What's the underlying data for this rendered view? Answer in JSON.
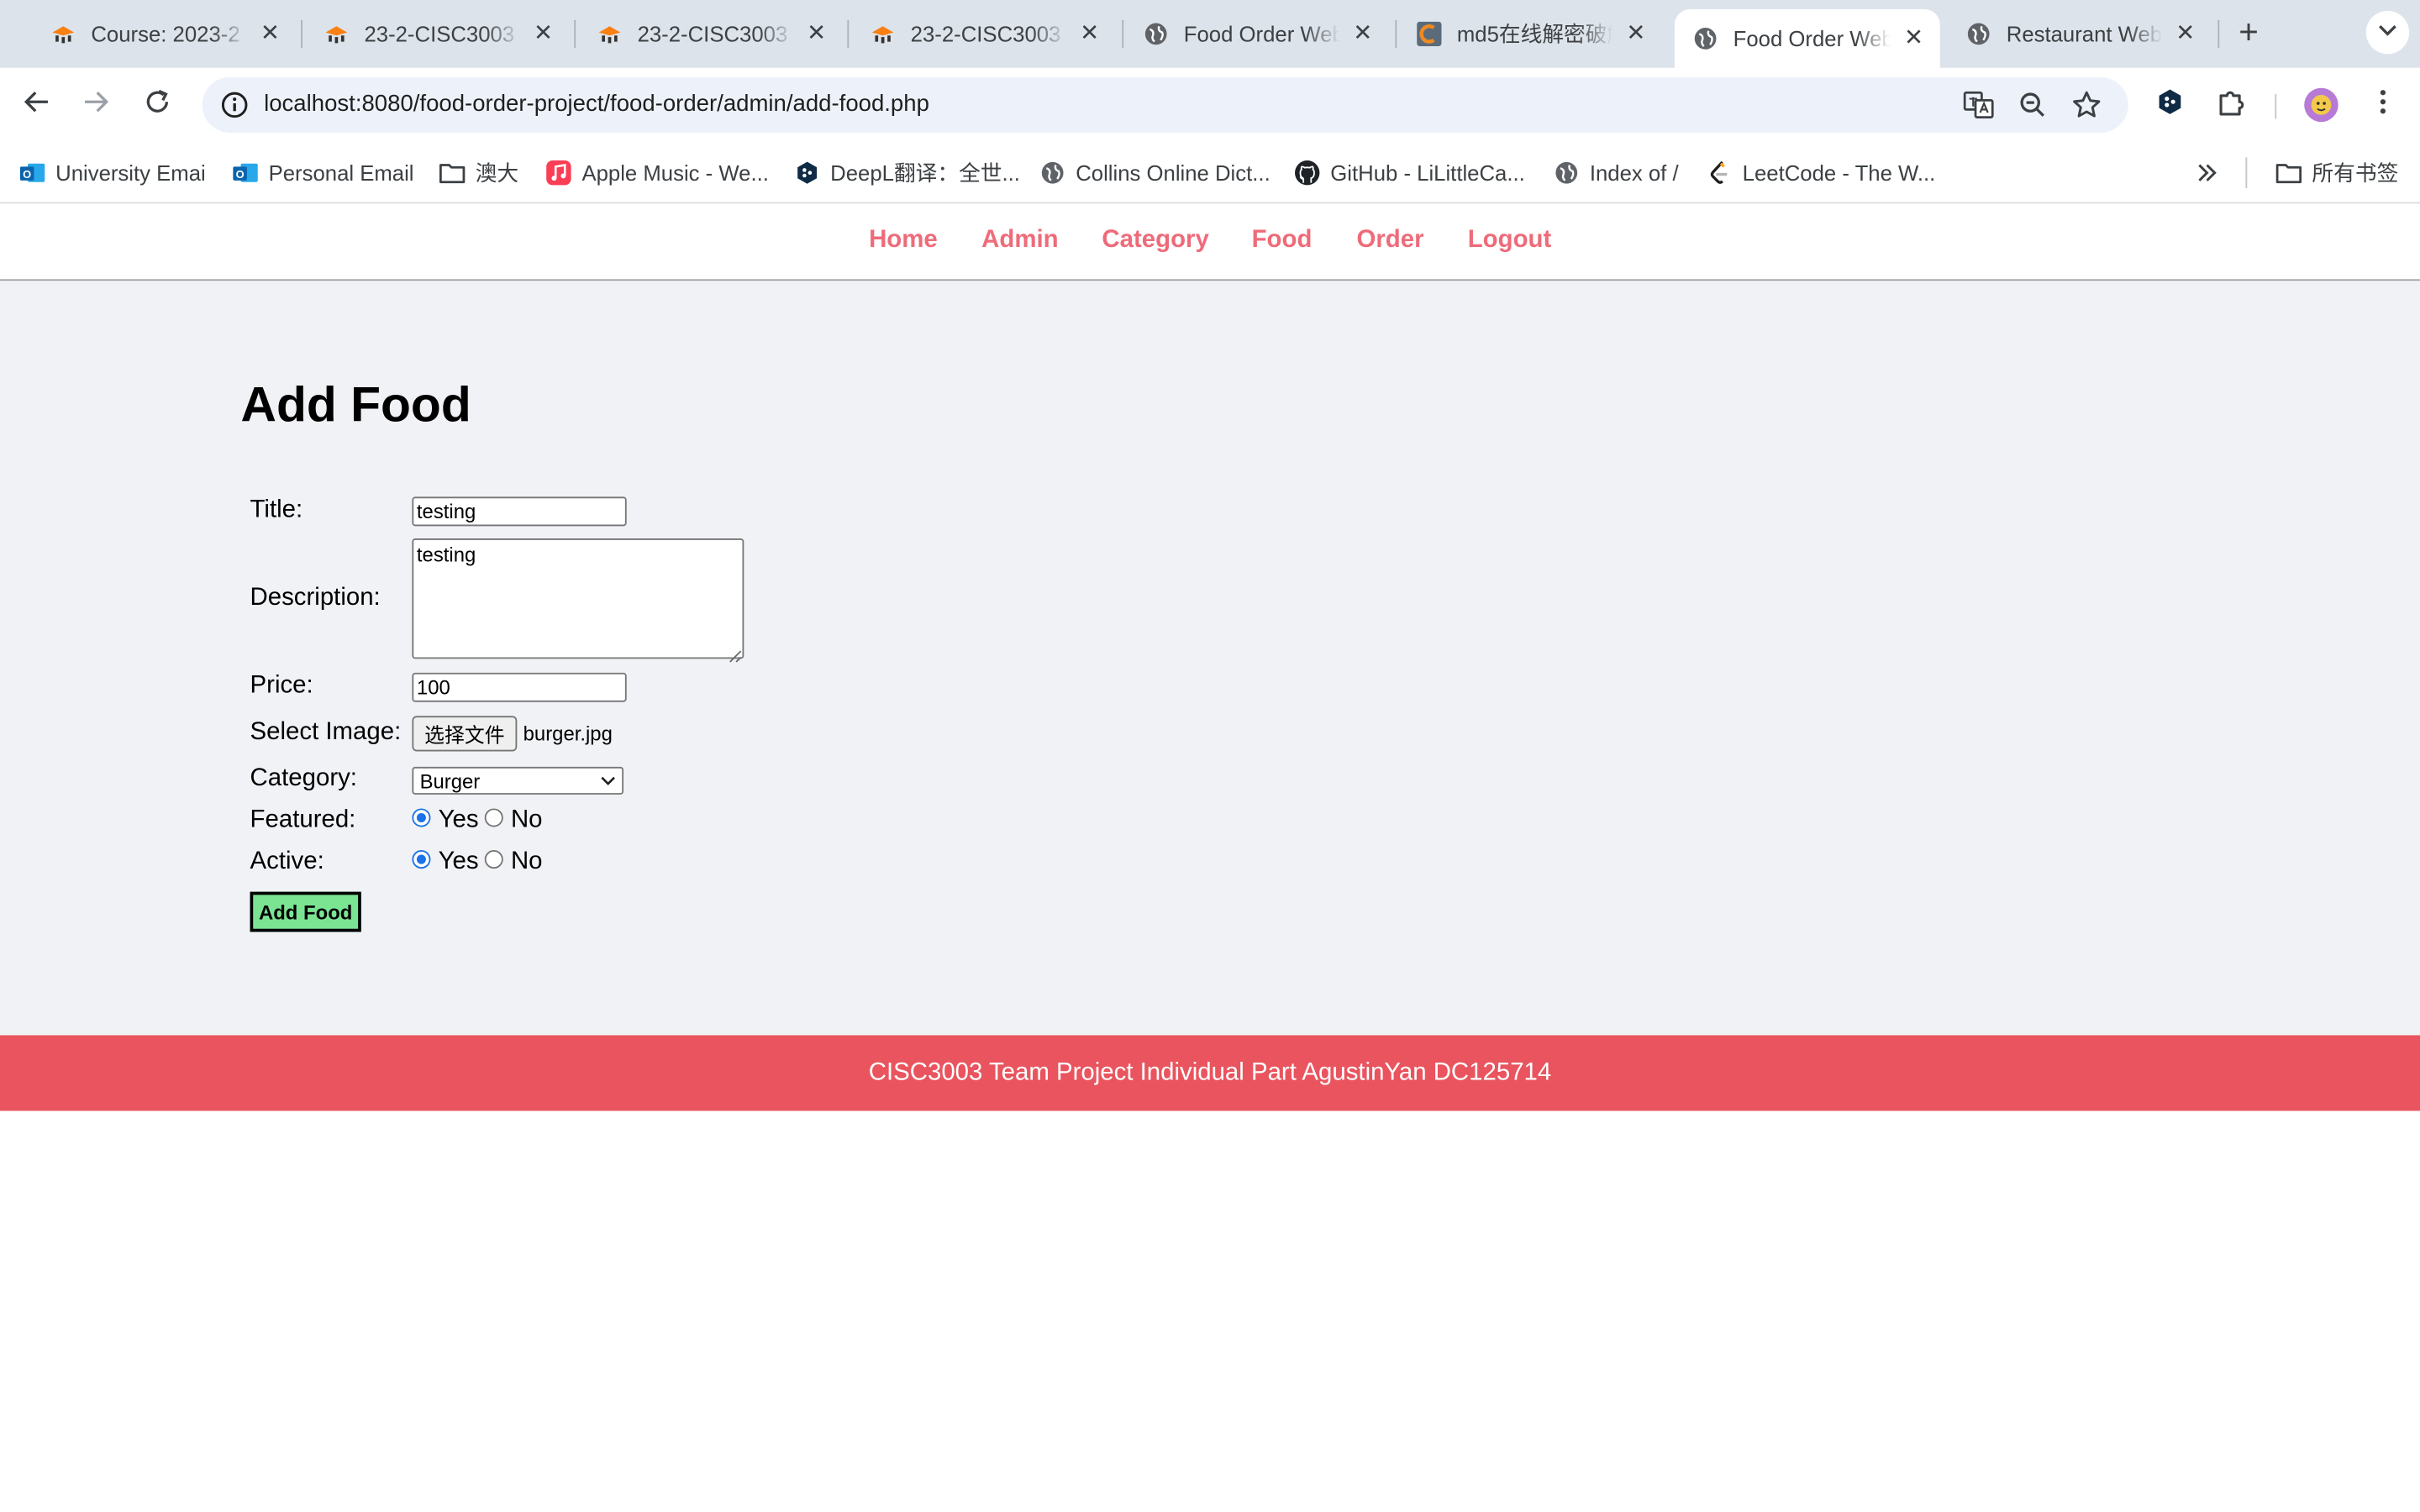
{
  "browser": {
    "tabs": [
      {
        "title": "Course: 2023-2",
        "icon": "moodle-icon",
        "active": false
      },
      {
        "title": "23-2-CISC3003",
        "icon": "moodle-icon",
        "active": false
      },
      {
        "title": "23-2-CISC3003",
        "icon": "moodle-icon",
        "active": false
      },
      {
        "title": "23-2-CISC3003",
        "icon": "moodle-icon",
        "active": false
      },
      {
        "title": "Food Order Web",
        "icon": "globe-icon",
        "active": false
      },
      {
        "title": "md5在线解密破解",
        "icon": "cmd5-icon",
        "active": false
      },
      {
        "title": "Food Order Web",
        "icon": "globe-icon",
        "active": true
      },
      {
        "title": "Restaurant Web",
        "icon": "globe-icon",
        "active": false
      }
    ],
    "url": "localhost:8080/food-order-project/food-order/admin/add-food.php",
    "bookmarks": [
      {
        "label": "University Emai",
        "icon": "outlook-icon"
      },
      {
        "label": "Personal Email",
        "icon": "outlook-icon"
      },
      {
        "label": "澳大",
        "icon": "folder-icon"
      },
      {
        "label": "Apple Music - We...",
        "icon": "apple-music-icon"
      },
      {
        "label": "DeepL翻译：全世...",
        "icon": "deepl-icon"
      },
      {
        "label": "Collins Online Dict...",
        "icon": "globe-icon"
      },
      {
        "label": "GitHub - LiLittleCa...",
        "icon": "github-icon"
      },
      {
        "label": "Index of /",
        "icon": "globe-icon"
      },
      {
        "label": "LeetCode - The W...",
        "icon": "leetcode-icon"
      }
    ],
    "other_bookmarks": "所有书签"
  },
  "nav": {
    "links": [
      "Home",
      "Admin",
      "Category",
      "Food",
      "Order",
      "Logout"
    ]
  },
  "form": {
    "heading": "Add Food",
    "title_label": "Title:",
    "title_value": "testing",
    "description_label": "Description:",
    "description_value": "testing",
    "price_label": "Price:",
    "price_value": "100",
    "image_label": "Select Image:",
    "file_button": "选择文件",
    "file_name": "burger.jpg",
    "category_label": "Category:",
    "category_value": "Burger",
    "featured_label": "Featured:",
    "featured_value": "Yes",
    "active_label": "Active:",
    "active_value": "Yes",
    "yes_label": "Yes",
    "no_label": "No",
    "submit_label": "Add Food"
  },
  "footer": {
    "text": "CISC3003 Team Project Individual Part AgustinYan DC125714"
  },
  "colors": {
    "nav_link": "#ee6b7a",
    "footer_bg": "#e9545e",
    "submit_bg": "#7be493",
    "page_bg": "#f1f2f6"
  }
}
